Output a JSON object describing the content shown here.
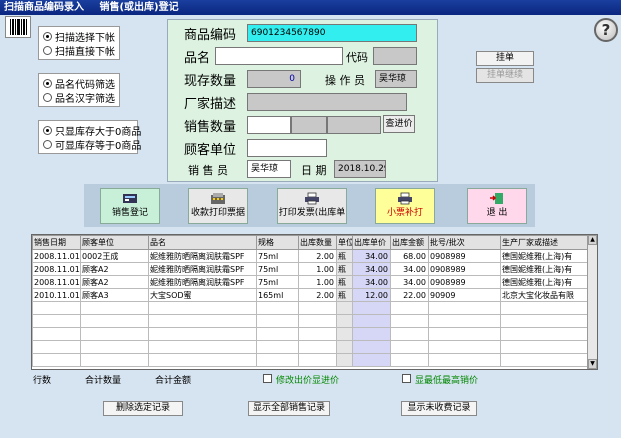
{
  "titlebar": {
    "part1": "扫描商品编码录入",
    "part2": "销售(或出库)登记"
  },
  "scan_mode": {
    "option1": "扫描选择下帐",
    "option2": "扫描直接下帐"
  },
  "filter_mode": {
    "option1": "品名代码筛选",
    "option2": "品名汉字筛选"
  },
  "stock_mode": {
    "option1": "只显库存大于0商品",
    "option2": "可显库存等于0商品"
  },
  "form": {
    "barcode_label": "商品编码",
    "barcode_value": "6901234567890",
    "name_label": "品名",
    "code_label": "代码",
    "stock_label": "现存数量",
    "stock_value": "0",
    "operator_label": "操 作 员",
    "operator_value": "吴华琼",
    "vendor_label": "厂家描述",
    "qty_label": "销售数量",
    "check_price_label": "查进价",
    "customer_label": "顾客单位",
    "salesperson_label": "销 售 员",
    "salesperson_value": "吴华琼",
    "date_label": "日 期",
    "date_value": "2018.10.29"
  },
  "side_buttons": {
    "hold": "挂单",
    "resume": "挂单继续"
  },
  "toolbar": {
    "sales_register": "销售登记",
    "print_receipt": "收款打印票据",
    "print_invoice": "打印发票(出库单",
    "small_ticket": "小票补打",
    "exit": "退 出"
  },
  "table": {
    "headers": [
      "销售日期",
      "顾客单位",
      "品名",
      "规格",
      "出库数量",
      "单位",
      "出库单价",
      "出库金额",
      "批号/批次",
      "生产厂家或描述"
    ],
    "rows": [
      [
        "2008.11.01",
        "0002王成",
        "妮维雅防晒隔离润肤霜SPF",
        "75ml",
        "2.00",
        "瓶",
        "34.00",
        "68.00",
        "0908989",
        "德国妮维雅(上海)有"
      ],
      [
        "2008.11.01",
        "顾客A2",
        "妮维雅防晒隔离润肤霜SPF",
        "75ml",
        "1.00",
        "瓶",
        "34.00",
        "34.00",
        "0908989",
        "德国妮维雅(上海)有"
      ],
      [
        "2008.11.01",
        "顾客A2",
        "妮维雅防晒隔离润肤霜SPF",
        "75ml",
        "1.00",
        "瓶",
        "34.00",
        "34.00",
        "0908989",
        "德国妮维雅(上海)有"
      ],
      [
        "2010.11.01",
        "顾客A3",
        "大宝SOD蜜",
        "165ml",
        "2.00",
        "瓶",
        "12.00",
        "22.00",
        "90909",
        "北京大宝化妆品有限"
      ]
    ]
  },
  "footer": {
    "rows_label": "行数",
    "total_qty_label": "合计数量",
    "total_amount_label": "合计金额",
    "show_cost_label": "修改出价显进价",
    "show_low_label": "显最低最高销价"
  },
  "bottom_buttons": {
    "delete": "删除选定记录",
    "show_all": "显示全部销售记录",
    "show_unpaid": "显示未收费记录"
  }
}
